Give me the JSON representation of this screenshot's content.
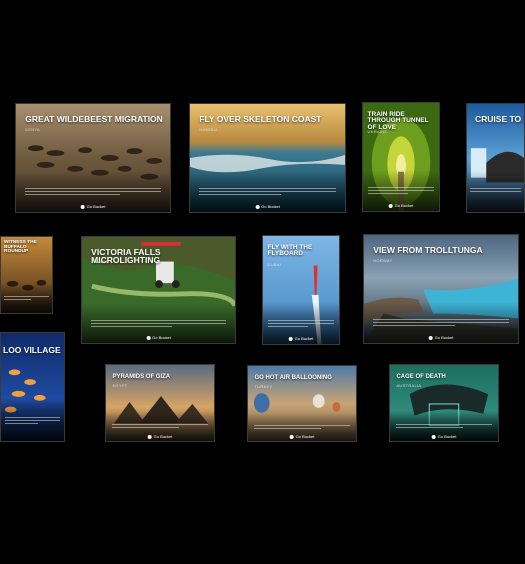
{
  "cards": [
    {
      "title": "GREAT WILDEBEEST MIGRATION",
      "subtitle": "KENYA"
    },
    {
      "title": "FLY OVER SKELETON COAST",
      "subtitle": "NAMIBIA"
    },
    {
      "title": "TRAIN RIDE THROUGH TUNNEL OF LOVE",
      "subtitle": "UKRAINE"
    },
    {
      "title": "CRUISE TO N",
      "subtitle": ""
    },
    {
      "title": "WITNESS THE BUFFALO ROUNDUP",
      "subtitle": ""
    },
    {
      "title": "VICTORIA FALLS MICROLIGHTING",
      "subtitle": "ZAMBIA"
    },
    {
      "title": "FLY WITH THE FLYBOARD",
      "subtitle": "DUBAI"
    },
    {
      "title": "VIEW FROM TROLLTUNGA",
      "subtitle": "NORWAY"
    },
    {
      "title": "LOO VILLAGE",
      "subtitle": ""
    },
    {
      "title": "PYRAMIDS OF GIZA",
      "subtitle": "EGYPT"
    },
    {
      "title": "GO HOT AIR BALLOONING",
      "subtitle": "TURKEY"
    },
    {
      "title": "CAGE OF DEATH",
      "subtitle": "AUSTRALIA"
    }
  ],
  "brand_label": "Go Bucket"
}
